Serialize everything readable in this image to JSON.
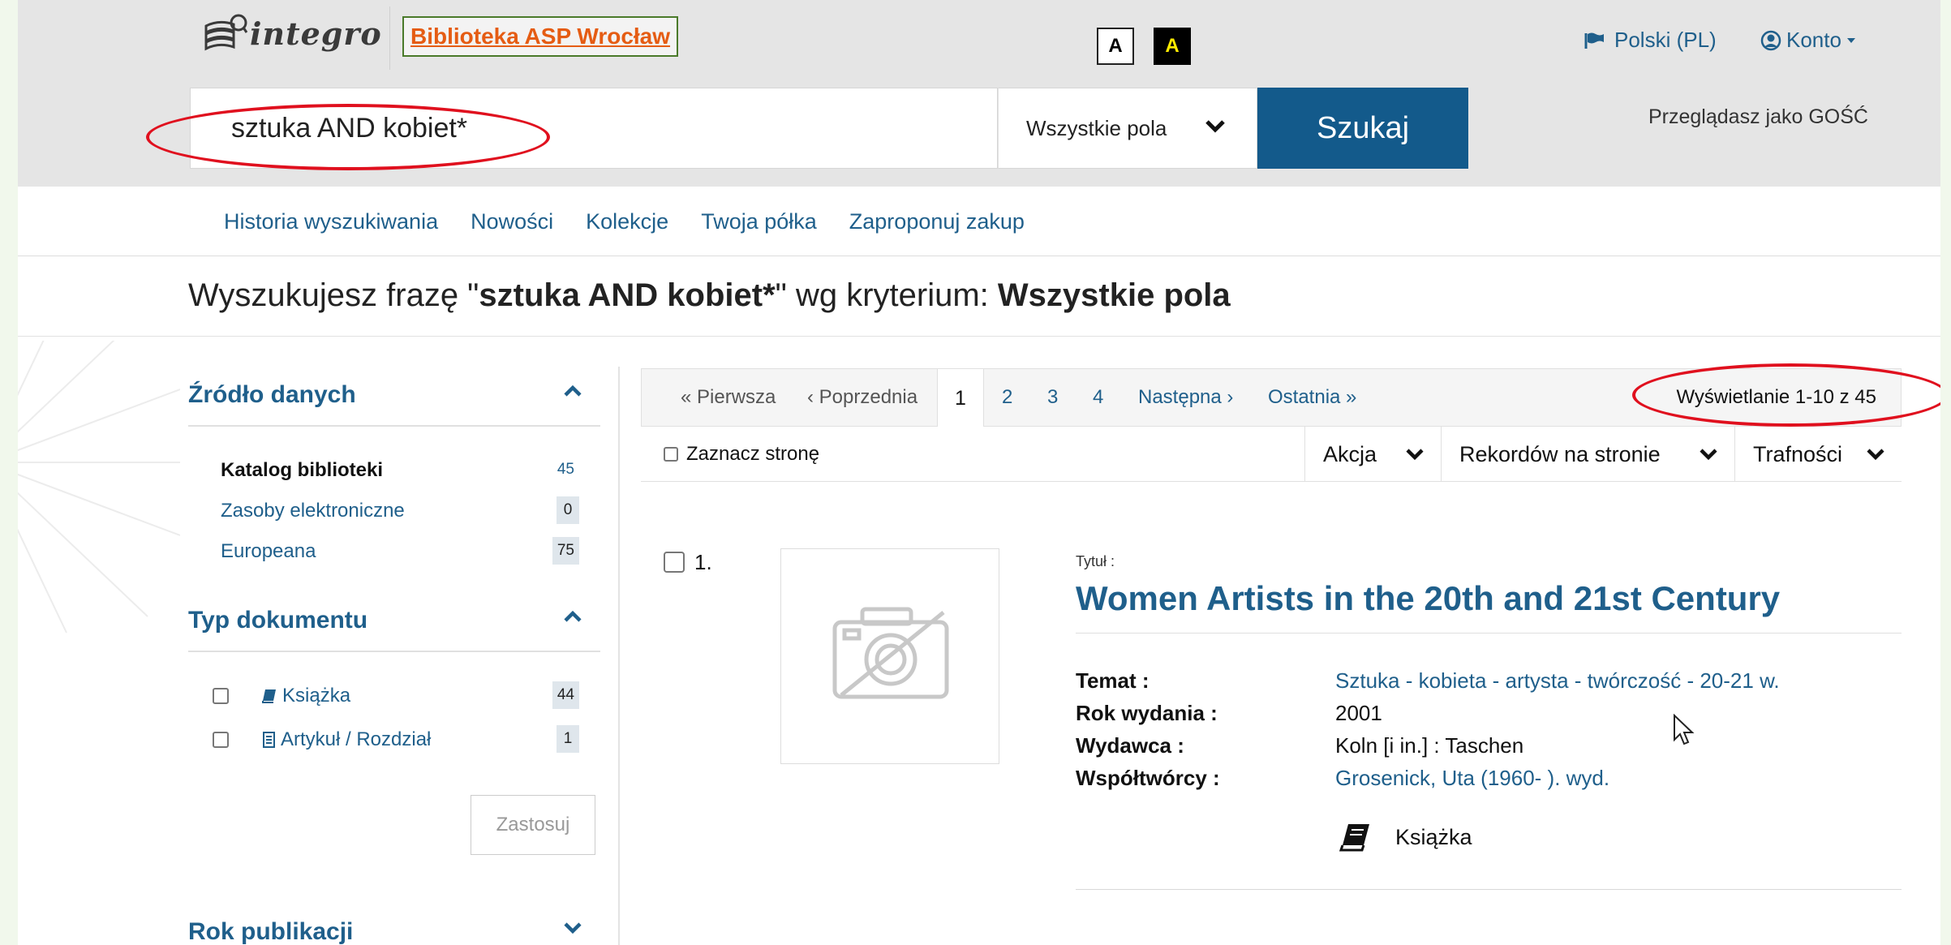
{
  "header": {
    "logo_text": "integro",
    "library_name": "Biblioteka ASP Wrocław",
    "contrast_normal": "A",
    "contrast_high": "A",
    "language": "Polski (PL)",
    "account": "Konto",
    "guest_text": "Przeglądasz jako GOŚĆ"
  },
  "search": {
    "query": "sztuka AND kobiet*",
    "field": "Wszystkie pola",
    "button": "Szukaj"
  },
  "nav": {
    "items": [
      "Historia wyszukiwania",
      "Nowości",
      "Kolekcje",
      "Twoja półka",
      "Zaproponuj zakup"
    ]
  },
  "query_summary": {
    "prefix": "Wyszukujesz frazę \"",
    "phrase": "sztuka AND kobiet*",
    "middle": "\" wg kryterium: ",
    "criterion": "Wszystkie pola"
  },
  "sidebar": {
    "source_title": "Źródło danych",
    "sources": [
      {
        "label": "Katalog biblioteki",
        "count": "45"
      },
      {
        "label": "Zasoby elektroniczne",
        "count": "0"
      },
      {
        "label": "Europeana",
        "count": "75"
      }
    ],
    "doctype_title": "Typ dokumentu",
    "doctypes": [
      {
        "label": "Książka",
        "count": "44"
      },
      {
        "label": "Artykuł / Rozdział",
        "count": "1"
      }
    ],
    "apply": "Zastosuj",
    "year_title": "Rok publikacji"
  },
  "pager": {
    "first": "« Pierwsza",
    "prev": "‹ Poprzednia",
    "pages": [
      "1",
      "2",
      "3",
      "4"
    ],
    "next": "Następna ›",
    "last": "Ostatnia »",
    "result_count": "Wyświetlanie 1-10 z 45"
  },
  "toolbar": {
    "select_page": "Zaznacz stronę",
    "action": "Akcja",
    "per_page": "Rekordów na stronie",
    "sort": "Trafności"
  },
  "results": [
    {
      "number": "1.",
      "title_label": "Tytuł :",
      "title": "Women Artists in the 20th and 21st Century",
      "meta": [
        {
          "key": "Temat :",
          "value": "Sztuka - kobieta - artysta - twórczość - 20-21 w."
        },
        {
          "key": "Rok wydania :",
          "value": "2001"
        },
        {
          "key": "Wydawca :",
          "value": "Koln [i in.] : Taschen"
        },
        {
          "key": "Współtwórcy :",
          "value": "Grosenick, Uta (1960- ). wyd."
        }
      ],
      "doc_type": "Książka"
    }
  ],
  "colors": {
    "accent": "#135a8b",
    "link": "#1f5f8b",
    "library_name": "#e55c13",
    "annotation": "#e0101e"
  }
}
